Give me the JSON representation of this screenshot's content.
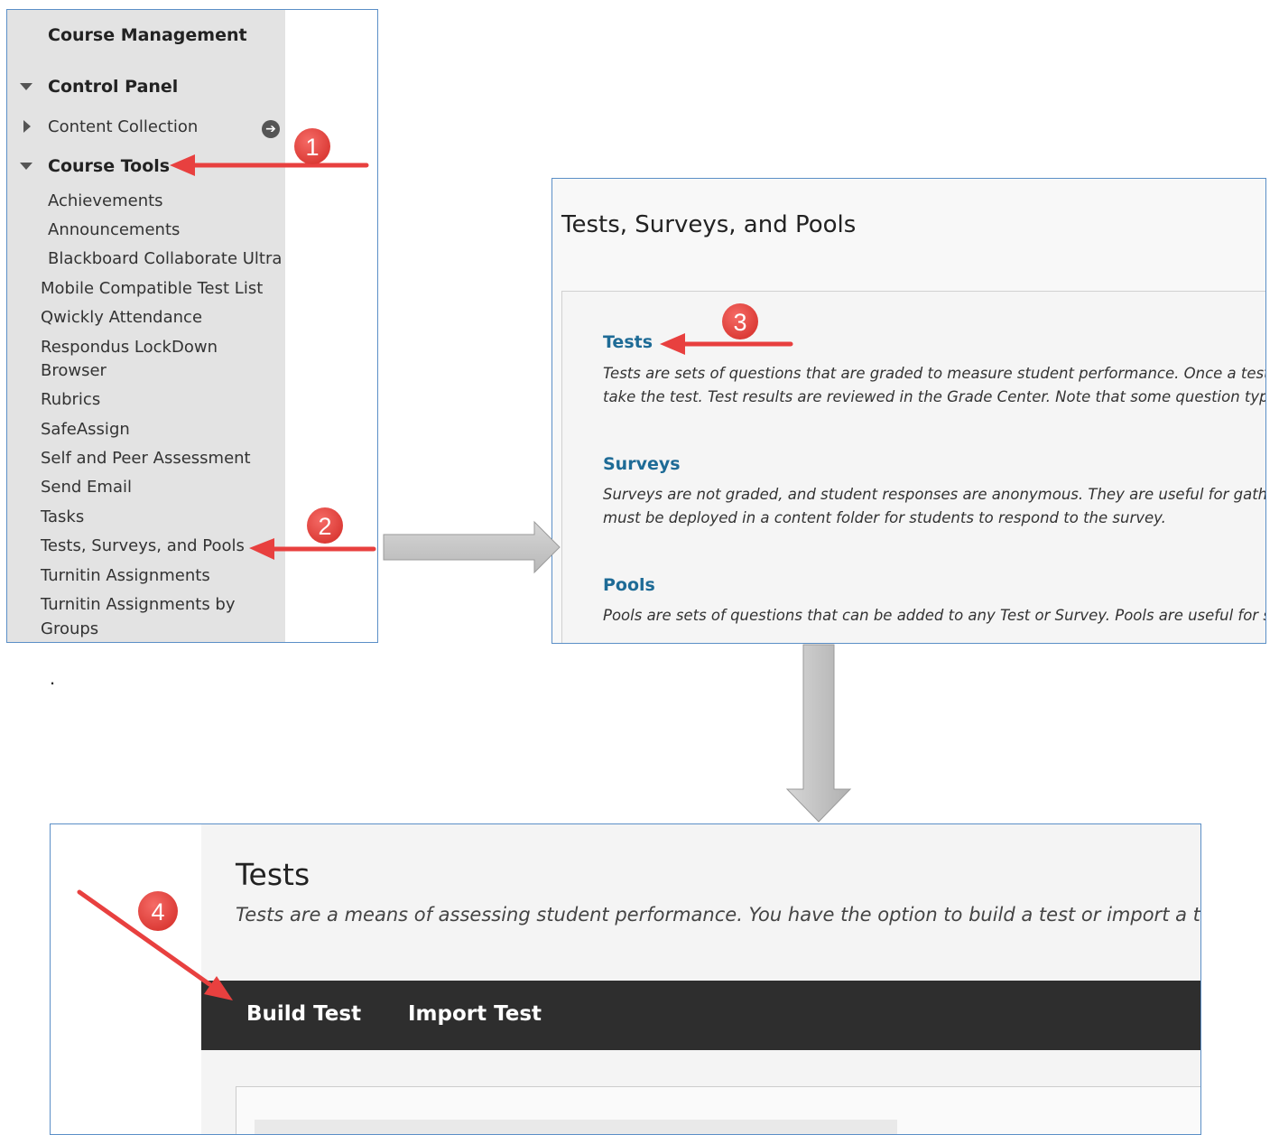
{
  "course_management": {
    "title": "Course Management",
    "control_panel": "Control Panel",
    "content_collection": "Content Collection",
    "course_tools": "Course Tools",
    "tools": [
      "Achievements",
      "Announcements",
      "Blackboard Collaborate Ultra",
      "Mobile Compatible Test List",
      "Qwickly Attendance",
      "Respondus LockDown",
      "Browser",
      "Rubrics",
      "SafeAssign",
      "Self and Peer Assessment",
      "Send Email",
      "Tasks",
      "Tests, Surveys, and Pools",
      "Turnitin Assignments",
      "Turnitin Assignments by",
      "Groups"
    ]
  },
  "tsp_page": {
    "title": "Tests, Surveys, and Pools",
    "sections": [
      {
        "link": "Tests",
        "desc_line1": "Tests are sets of questions that are graded to measure student performance. Once a test is cr",
        "desc_line2": "take the test. Test results are reviewed in the Grade Center. Note that some question types ar"
      },
      {
        "link": "Surveys",
        "desc_line1": "Surveys are not graded, and student responses are anonymous. They are useful for gathering",
        "desc_line2": "must be deployed in a content folder for students to respond to the survey."
      },
      {
        "link": "Pools",
        "desc_line1": "Pools are sets of questions that can be added to any Test or Survey. Pools are useful for stori",
        "desc_line2": ""
      }
    ]
  },
  "tests_page": {
    "title": "Tests",
    "description": "Tests are a means of assessing student performance. You have the option to build a test or import a test. I",
    "build_test": "Build Test",
    "import_test": "Import Test"
  },
  "annotations": {
    "badges": [
      "1",
      "2",
      "3",
      "4"
    ],
    "dot": ".",
    "badge_color": "#e8403f",
    "arrow_color": "#e8403f",
    "flow_arrow_color": "#c8c8c8"
  }
}
